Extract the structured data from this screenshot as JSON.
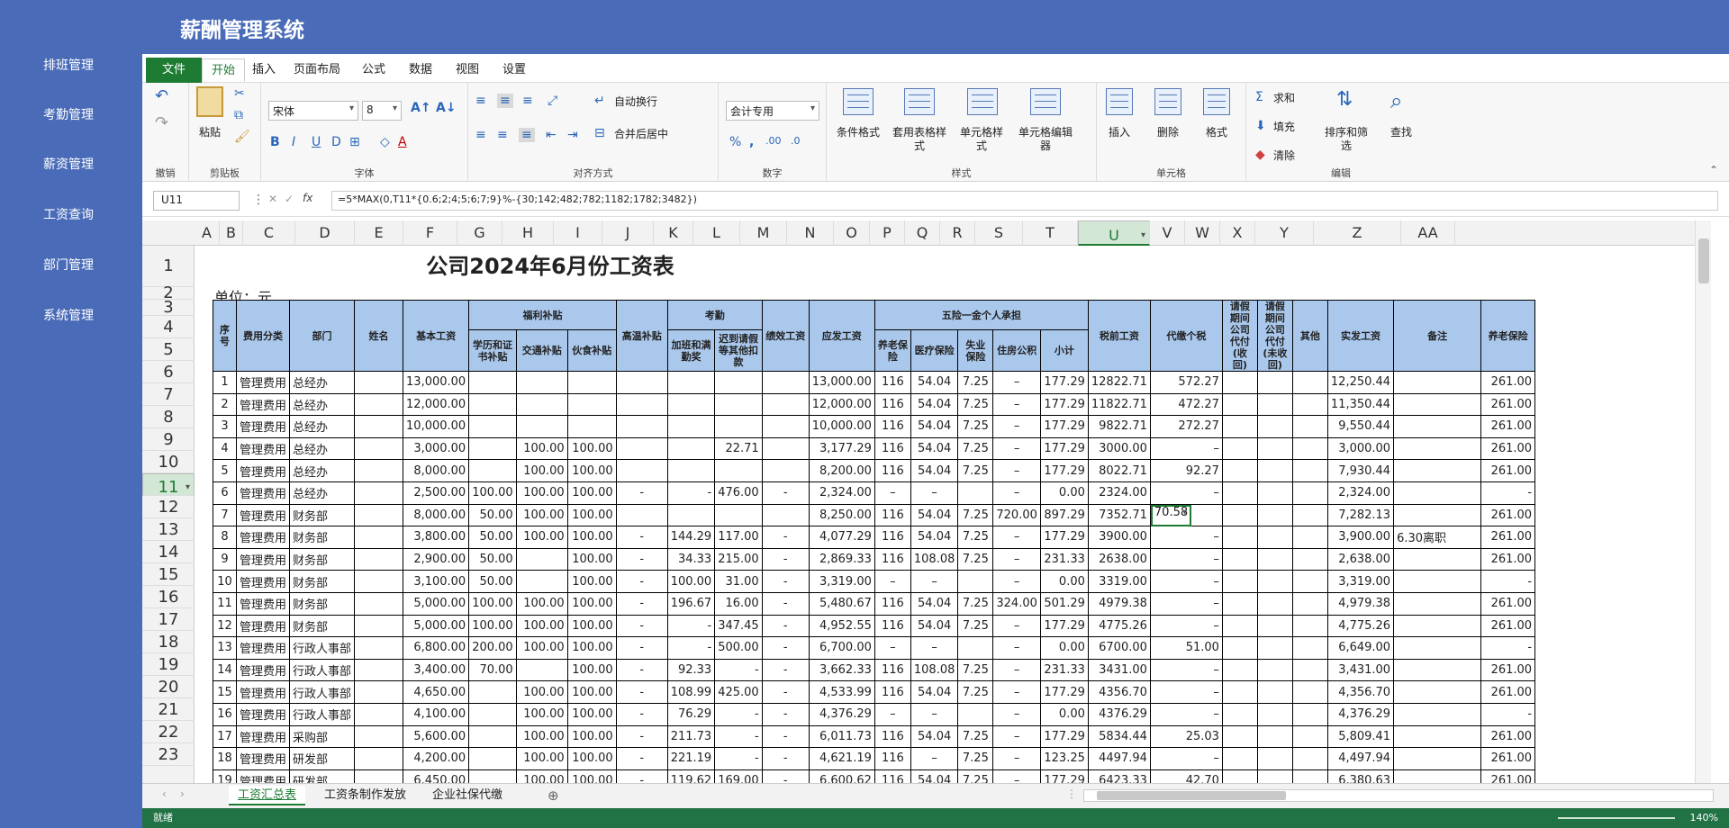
{
  "app": {
    "title": "薪酬管理系统"
  },
  "sidebar": {
    "items": [
      {
        "label": "排班管理",
        "icon": "grid-icon"
      },
      {
        "label": "考勤管理",
        "icon": "doc-icon"
      },
      {
        "label": "薪资管理",
        "icon": "wallet-icon"
      },
      {
        "label": "工资查询",
        "icon": "search-icon"
      },
      {
        "label": "部门管理",
        "icon": "link-icon"
      },
      {
        "label": "系统管理",
        "icon": "home-icon"
      }
    ]
  },
  "tabs": {
    "file": "文件",
    "items": [
      "开始",
      "插入",
      "页面布局",
      "公式",
      "数据",
      "视图",
      "设置"
    ]
  },
  "ribbon": {
    "groups": [
      "撤销",
      "剪贴板",
      "字体",
      "对齐方式",
      "数字",
      "样式",
      "单元格",
      "编辑"
    ],
    "paste": "粘贴",
    "font_name": "宋体",
    "font_size": "8",
    "wrap": "自动换行",
    "merge": "合并后居中",
    "num_format": "会计专用",
    "cond_format": "条件格式",
    "table_format": "套用表格样式",
    "cell_style": "单元格样式",
    "cell_editor": "单元格编辑器",
    "insert": "插入",
    "delete": "删除",
    "format": "格式",
    "sum": "求和",
    "fill": "填充",
    "clear": "清除",
    "sort": "排序和筛选",
    "find": "查找"
  },
  "formula_bar": {
    "namebox": "U11",
    "formula": "=5*MAX(0,T11*{0.6;2;4;5;6;7;9}%-{30;142;482;782;1182;1782;3482})"
  },
  "columns": [
    "A",
    "B",
    "C",
    "D",
    "E",
    "F",
    "G",
    "H",
    "I",
    "J",
    "K",
    "L",
    "M",
    "N",
    "O",
    "P",
    "Q",
    "R",
    "S",
    "T",
    "U",
    "V",
    "W",
    "X",
    "Y",
    "Z",
    "AA"
  ],
  "selected_column": "U",
  "rows": [
    "1",
    "2",
    "3",
    "4",
    "5",
    "6",
    "7",
    "8",
    "9",
    "10",
    "11",
    "12",
    "13",
    "14",
    "15",
    "16",
    "17",
    "18",
    "19",
    "20",
    "21",
    "22",
    "23"
  ],
  "selected_row": "11",
  "sheet": {
    "title": "公司2024年6月份工资表",
    "unit": "单位：元",
    "group_headers": {
      "welfare": "福利补贴",
      "attendance": "考勤",
      "insurance": "五险一金个人承担"
    },
    "headers": [
      "序号",
      "费用分类",
      "部门",
      "姓名",
      "基本工资",
      "学历和证书补贴",
      "交通补贴",
      "伙食补贴",
      "高温补贴",
      "加班和满勤奖",
      "迟到请假等其他扣款",
      "绩效工资",
      "应发工资",
      "养老保险",
      "医疗保险",
      "失业保险",
      "住房公积",
      "小计",
      "税前工资",
      "代缴个税",
      "请假期间公司代付(收回)",
      "请假期间公司代付(未收回)",
      "其他",
      "实发工资",
      "备注",
      "养老保险"
    ],
    "data": [
      [
        "1",
        "管理费用",
        "总经办",
        "",
        "13,000.00",
        "",
        "",
        "",
        "",
        "",
        "",
        "",
        "13,000.00",
        "116",
        "54.04",
        "7.25",
        "–",
        "177.29",
        "12822.71",
        "572.27",
        "",
        "",
        "",
        "12,250.44",
        "",
        "261.00"
      ],
      [
        "2",
        "管理费用",
        "总经办",
        "",
        "12,000.00",
        "",
        "",
        "",
        "",
        "",
        "",
        "",
        "12,000.00",
        "116",
        "54.04",
        "7.25",
        "–",
        "177.29",
        "11822.71",
        "472.27",
        "",
        "",
        "",
        "11,350.44",
        "",
        "261.00"
      ],
      [
        "3",
        "管理费用",
        "总经办",
        "",
        "10,000.00",
        "",
        "",
        "",
        "",
        "",
        "",
        "",
        "10,000.00",
        "116",
        "54.04",
        "7.25",
        "–",
        "177.29",
        "9822.71",
        "272.27",
        "",
        "",
        "",
        "9,550.44",
        "",
        "261.00"
      ],
      [
        "4",
        "管理费用",
        "总经办",
        "",
        "3,000.00",
        "",
        "100.00",
        "100.00",
        "",
        "",
        "22.71",
        "",
        "3,177.29",
        "116",
        "54.04",
        "7.25",
        "–",
        "177.29",
        "3000.00",
        "–",
        "",
        "",
        "",
        "3,000.00",
        "",
        "261.00"
      ],
      [
        "5",
        "管理费用",
        "总经办",
        "",
        "8,000.00",
        "",
        "100.00",
        "100.00",
        "",
        "",
        "",
        "",
        "8,200.00",
        "116",
        "54.04",
        "7.25",
        "–",
        "177.29",
        "8022.71",
        "92.27",
        "",
        "",
        "",
        "7,930.44",
        "",
        "261.00"
      ],
      [
        "6",
        "管理费用",
        "总经办",
        "",
        "2,500.00",
        "100.00",
        "100.00",
        "100.00",
        "-",
        "-",
        "476.00",
        "-",
        "2,324.00",
        "–",
        "–",
        "",
        "–",
        "0.00",
        "2324.00",
        "–",
        "",
        "",
        "",
        "2,324.00",
        "",
        "-"
      ],
      [
        "7",
        "管理费用",
        "财务部",
        "",
        "8,000.00",
        "50.00",
        "100.00",
        "100.00",
        "",
        "",
        "",
        "",
        "8,250.00",
        "116",
        "54.04",
        "7.25",
        "720.00",
        "897.29",
        "7352.71",
        "70.58",
        "",
        "",
        "",
        "7,282.13",
        "",
        "261.00"
      ],
      [
        "8",
        "管理费用",
        "财务部",
        "",
        "3,800.00",
        "50.00",
        "100.00",
        "100.00",
        "-",
        "144.29",
        "117.00",
        "-",
        "4,077.29",
        "116",
        "54.04",
        "7.25",
        "–",
        "177.29",
        "3900.00",
        "–",
        "",
        "",
        "",
        "3,900.00",
        "6.30离职",
        "261.00"
      ],
      [
        "9",
        "管理费用",
        "财务部",
        "",
        "2,900.00",
        "50.00",
        "",
        "100.00",
        "-",
        "34.33",
        "215.00",
        "-",
        "2,869.33",
        "116",
        "108.08",
        "7.25",
        "–",
        "231.33",
        "2638.00",
        "–",
        "",
        "",
        "",
        "2,638.00",
        "",
        "261.00"
      ],
      [
        "10",
        "管理费用",
        "财务部",
        "",
        "3,100.00",
        "50.00",
        "",
        "100.00",
        "-",
        "100.00",
        "31.00",
        "-",
        "3,319.00",
        "–",
        "–",
        "",
        "–",
        "0.00",
        "3319.00",
        "–",
        "",
        "",
        "",
        "3,319.00",
        "",
        "-"
      ],
      [
        "11",
        "管理费用",
        "财务部",
        "",
        "5,000.00",
        "100.00",
        "100.00",
        "100.00",
        "-",
        "196.67",
        "16.00",
        "-",
        "5,480.67",
        "116",
        "54.04",
        "7.25",
        "324.00",
        "501.29",
        "4979.38",
        "–",
        "",
        "",
        "",
        "4,979.38",
        "",
        "261.00"
      ],
      [
        "12",
        "管理费用",
        "财务部",
        "",
        "5,000.00",
        "100.00",
        "100.00",
        "100.00",
        "-",
        "-",
        "347.45",
        "-",
        "4,952.55",
        "116",
        "54.04",
        "7.25",
        "–",
        "177.29",
        "4775.26",
        "–",
        "",
        "",
        "",
        "4,775.26",
        "",
        "261.00"
      ],
      [
        "13",
        "管理费用",
        "行政人事部",
        "",
        "6,800.00",
        "200.00",
        "100.00",
        "100.00",
        "-",
        "-",
        "500.00",
        "-",
        "6,700.00",
        "–",
        "–",
        "",
        "–",
        "0.00",
        "6700.00",
        "51.00",
        "",
        "",
        "",
        "6,649.00",
        "",
        "-"
      ],
      [
        "14",
        "管理费用",
        "行政人事部",
        "",
        "3,400.00",
        "70.00",
        "",
        "100.00",
        "-",
        "92.33",
        "-",
        "-",
        "3,662.33",
        "116",
        "108.08",
        "7.25",
        "–",
        "231.33",
        "3431.00",
        "–",
        "",
        "",
        "",
        "3,431.00",
        "",
        "261.00"
      ],
      [
        "15",
        "管理费用",
        "行政人事部",
        "",
        "4,650.00",
        "",
        "100.00",
        "100.00",
        "-",
        "108.99",
        "425.00",
        "-",
        "4,533.99",
        "116",
        "54.04",
        "7.25",
        "–",
        "177.29",
        "4356.70",
        "–",
        "",
        "",
        "",
        "4,356.70",
        "",
        "261.00"
      ],
      [
        "16",
        "管理费用",
        "行政人事部",
        "",
        "4,100.00",
        "",
        "100.00",
        "100.00",
        "-",
        "76.29",
        "-",
        "-",
        "4,376.29",
        "–",
        "–",
        "",
        "–",
        "0.00",
        "4376.29",
        "–",
        "",
        "",
        "",
        "4,376.29",
        "",
        "-"
      ],
      [
        "17",
        "管理费用",
        "采购部",
        "",
        "5,600.00",
        "",
        "100.00",
        "100.00",
        "-",
        "211.73",
        "-",
        "-",
        "6,011.73",
        "116",
        "54.04",
        "7.25",
        "–",
        "177.29",
        "5834.44",
        "25.03",
        "",
        "",
        "",
        "5,809.41",
        "",
        "261.00"
      ],
      [
        "18",
        "管理费用",
        "研发部",
        "",
        "4,200.00",
        "",
        "100.00",
        "100.00",
        "-",
        "221.19",
        "-",
        "-",
        "4,621.19",
        "116",
        "–",
        "7.25",
        "–",
        "123.25",
        "4497.94",
        "–",
        "",
        "",
        "",
        "4,497.94",
        "",
        "261.00"
      ],
      [
        "19",
        "管理费用",
        "研发部",
        "",
        "6,450.00",
        "",
        "100.00",
        "100.00",
        "-",
        "119.62",
        "169.00",
        "-",
        "6,600.62",
        "116",
        "54.04",
        "7.25",
        "–",
        "177.29",
        "6423.33",
        "42.70",
        "",
        "",
        "",
        "6,380.63",
        "",
        "261.00"
      ]
    ]
  },
  "sheet_tabs": [
    "工资汇总表",
    "工资条制作发放",
    "企业社保代缴"
  ],
  "status": {
    "ready": "就绪",
    "zoom": "140%"
  }
}
